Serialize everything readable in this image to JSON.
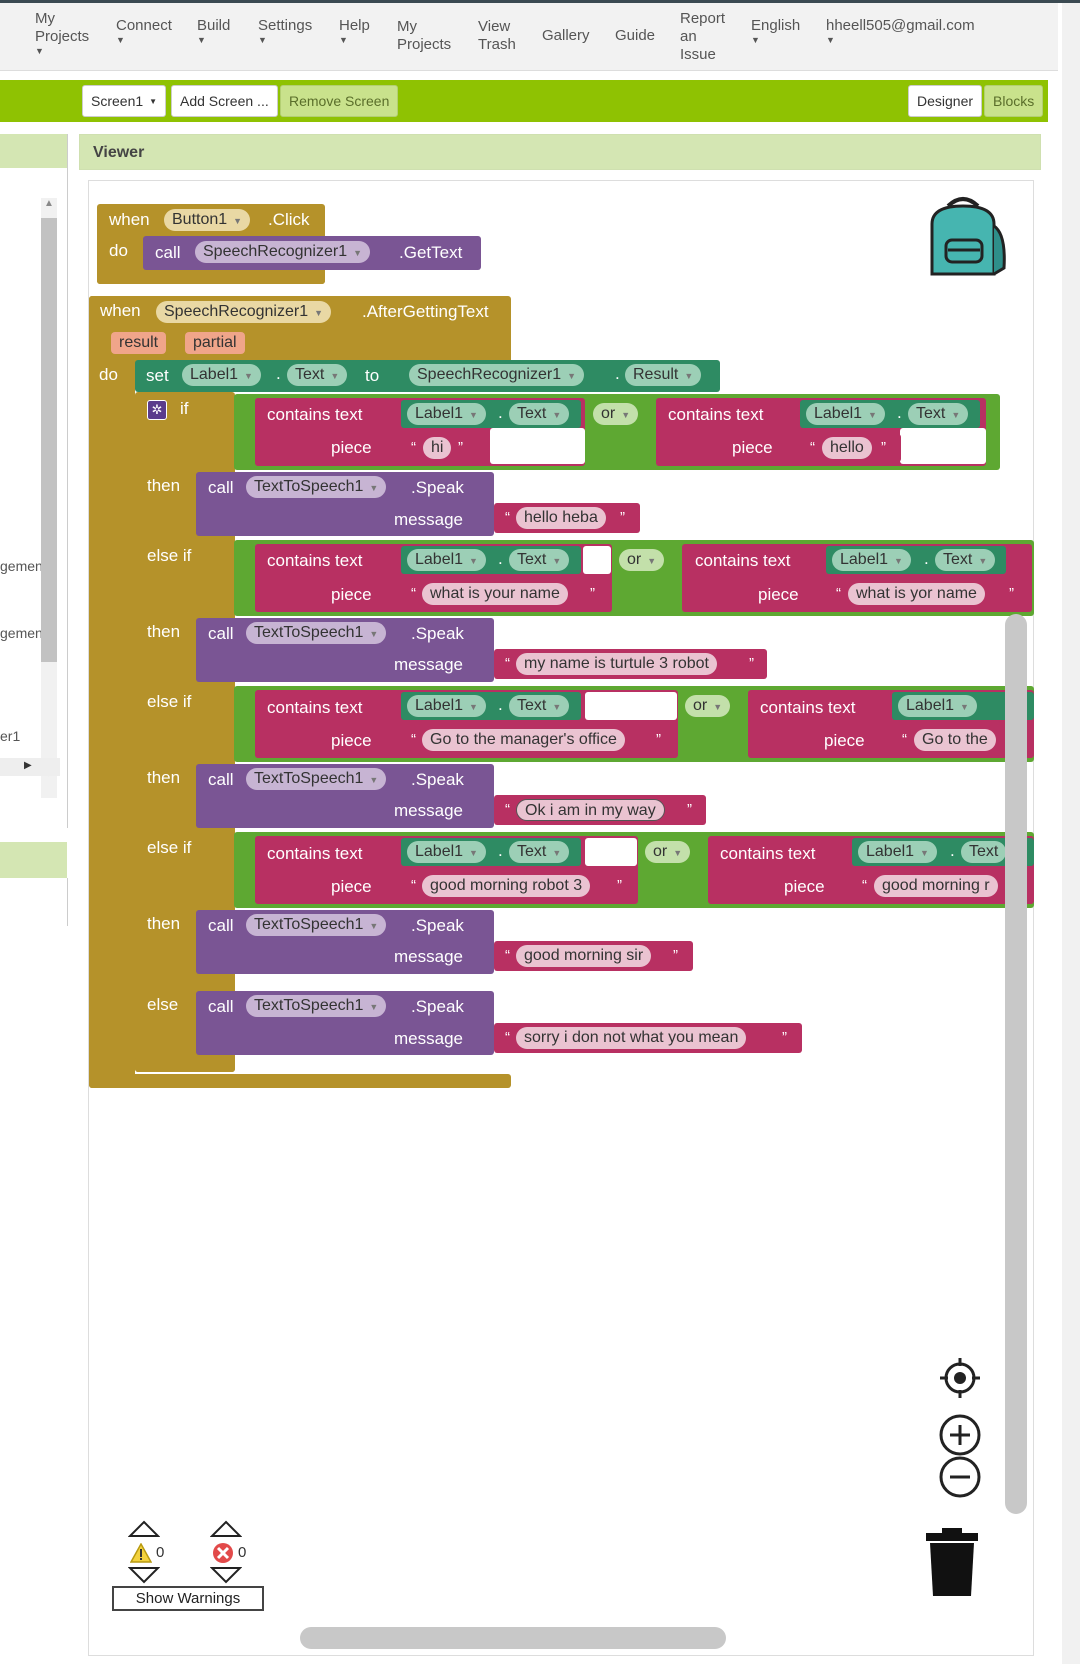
{
  "nav": {
    "my_projects_menu": "My\nProjects",
    "connect": "Connect",
    "build": "Build",
    "settings": "Settings",
    "help": "Help",
    "my_projects": "My\nProjects",
    "view_trash": "View\nTrash",
    "gallery": "Gallery",
    "guide": "Guide",
    "report": "Report\nan\nIssue",
    "language": "English",
    "user": "hheell505@gmail.com"
  },
  "toolbar": {
    "screen": "Screen1",
    "add_screen": "Add Screen ...",
    "remove_screen": "Remove Screen",
    "designer": "Designer",
    "blocks": "Blocks"
  },
  "left_panel": {
    "items": [
      "gemen",
      "gemen",
      "er1"
    ]
  },
  "viewer": {
    "title": "Viewer"
  },
  "blocks": {
    "when": "when",
    "do": "do",
    "call": "call",
    "set": "set",
    "to": "to",
    "if": "if",
    "then": "then",
    "else_if": "else if",
    "else": "else",
    "or": "or",
    "dot": ".",
    "contains_text": "contains  text",
    "piece": "piece",
    "message": "message",
    "button1": "Button1",
    "click": ".Click",
    "sr1": "SpeechRecognizer1",
    "gettext": ".GetText",
    "aftergettingtext": ".AfterGettingText",
    "result_arg": "result",
    "partial_arg": "partial",
    "label1": "Label1",
    "text_prop": "Text",
    "result_prop": "Result",
    "tts1": "TextToSpeech1",
    "speak": ".Speak",
    "s_hi": "hi",
    "s_hello": "hello",
    "s_hello_heba": "hello heba",
    "s_what_name": "what is your name",
    "s_what_yor": "what is yor name",
    "s_my_name": "my name is turtule 3 robot",
    "s_manager": "Go to the manager's office",
    "s_manager_cut": "Go to the",
    "s_ok": "Ok i am in my way",
    "s_gm_robot": "good morning robot 3",
    "s_gm_cut": "good morning r",
    "s_gm_sir": "good morning sir",
    "s_sorry": "sorry i don not what you mean"
  },
  "warnings": {
    "warn_count": "0",
    "err_count": "0",
    "show_label": "Show Warnings"
  }
}
